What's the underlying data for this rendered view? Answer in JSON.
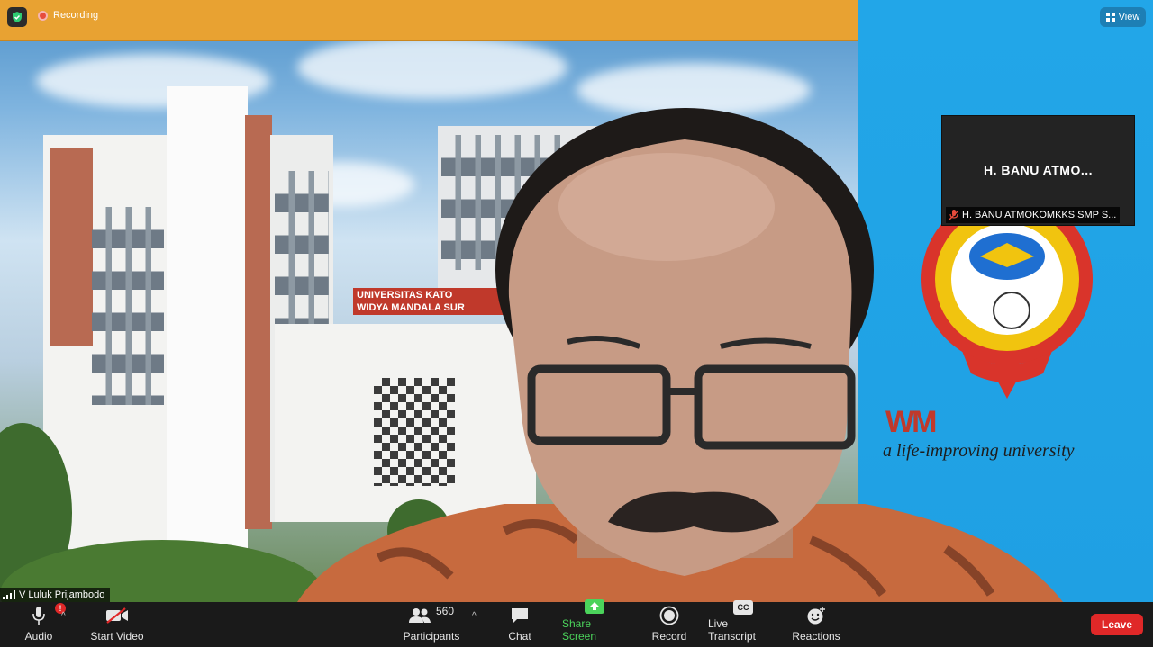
{
  "topbar": {
    "recording_label": "Recording",
    "view_label": "View"
  },
  "tile": {
    "name_display": "H. BANU ATMO...",
    "name_full": "H. BANU ATMOKOMKKS SMP S..."
  },
  "self_label": "V Luluk Prijambodo",
  "background": {
    "sign_line1": "UNIVERSITAS KATO",
    "sign_line2": "WIDYA MANDALA SUR",
    "tagline": "a life-improving university",
    "logo_text": "WM"
  },
  "toolbar": {
    "audio": "Audio",
    "audio_badge": "!",
    "start_video": "Start Video",
    "participants": "Participants",
    "participants_count": "560",
    "chat": "Chat",
    "share_screen": "Share Screen",
    "record": "Record",
    "live_transcript": "Live Transcript",
    "cc": "CC",
    "reactions": "Reactions",
    "leave": "Leave"
  },
  "colors": {
    "recording_bar": "#e8a232",
    "leave": "#e02828",
    "share": "#4bd35b",
    "panel_blue": "#22a6e8"
  }
}
